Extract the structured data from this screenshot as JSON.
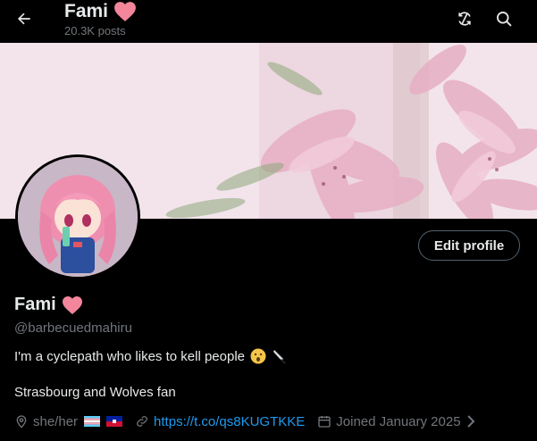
{
  "header": {
    "name": "Fami",
    "posts_count": "20.3K posts"
  },
  "profile": {
    "edit_label": "Edit profile",
    "display_name": "Fami",
    "handle": "@barbecuedmahiru",
    "bio_line1": "I'm a cyclepath who likes to kell people",
    "bio_line2": "Strasbourg and Wolves fan",
    "pronouns": "she/her",
    "link": "https://t.co/qs8KUGTKKE",
    "joined": "Joined January 2025"
  },
  "colors": {
    "background": "#000000",
    "text": "#e7e9ea",
    "muted": "#71767b",
    "link": "#1d9bf0",
    "heart": "#f4869b"
  },
  "icons": [
    "back-arrow-icon",
    "heart-emoji-icon",
    "refresh-icon",
    "search-icon",
    "location-icon",
    "link-icon",
    "calendar-icon",
    "chevron-right-icon"
  ]
}
